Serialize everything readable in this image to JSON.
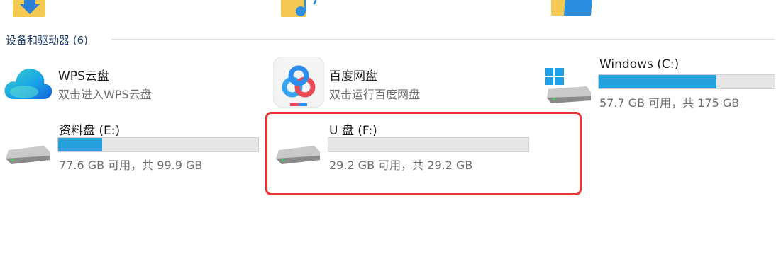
{
  "section": {
    "title": "设备和驱动器 (6)"
  },
  "items": {
    "wps": {
      "name": "WPS云盘",
      "subtitle": "双击进入WPS云盘",
      "icon": "wps-cloud-icon"
    },
    "baidu": {
      "name": "百度网盘",
      "subtitle": "双击运行百度网盘",
      "icon": "baidu-netdisk-icon"
    },
    "windows_c": {
      "name": "Windows (C:)",
      "space": "57.7 GB 可用，共 175 GB",
      "used_fraction": 0.67,
      "icon": "windows-drive-icon"
    },
    "data_e": {
      "name": "资料盘 (E:)",
      "space": "77.6 GB 可用，共 99.9 GB",
      "used_fraction": 0.22,
      "icon": "hard-drive-icon"
    },
    "usb_f": {
      "name": "U 盘 (F:)",
      "space": "29.2 GB 可用，共 29.2 GB",
      "used_fraction": 0.0,
      "icon": "usb-drive-icon"
    }
  },
  "colors": {
    "bar_fill": "#26a0da",
    "bar_track": "#e6e6e6",
    "highlight": "#e53535",
    "section_title": "#1e3a6e"
  }
}
